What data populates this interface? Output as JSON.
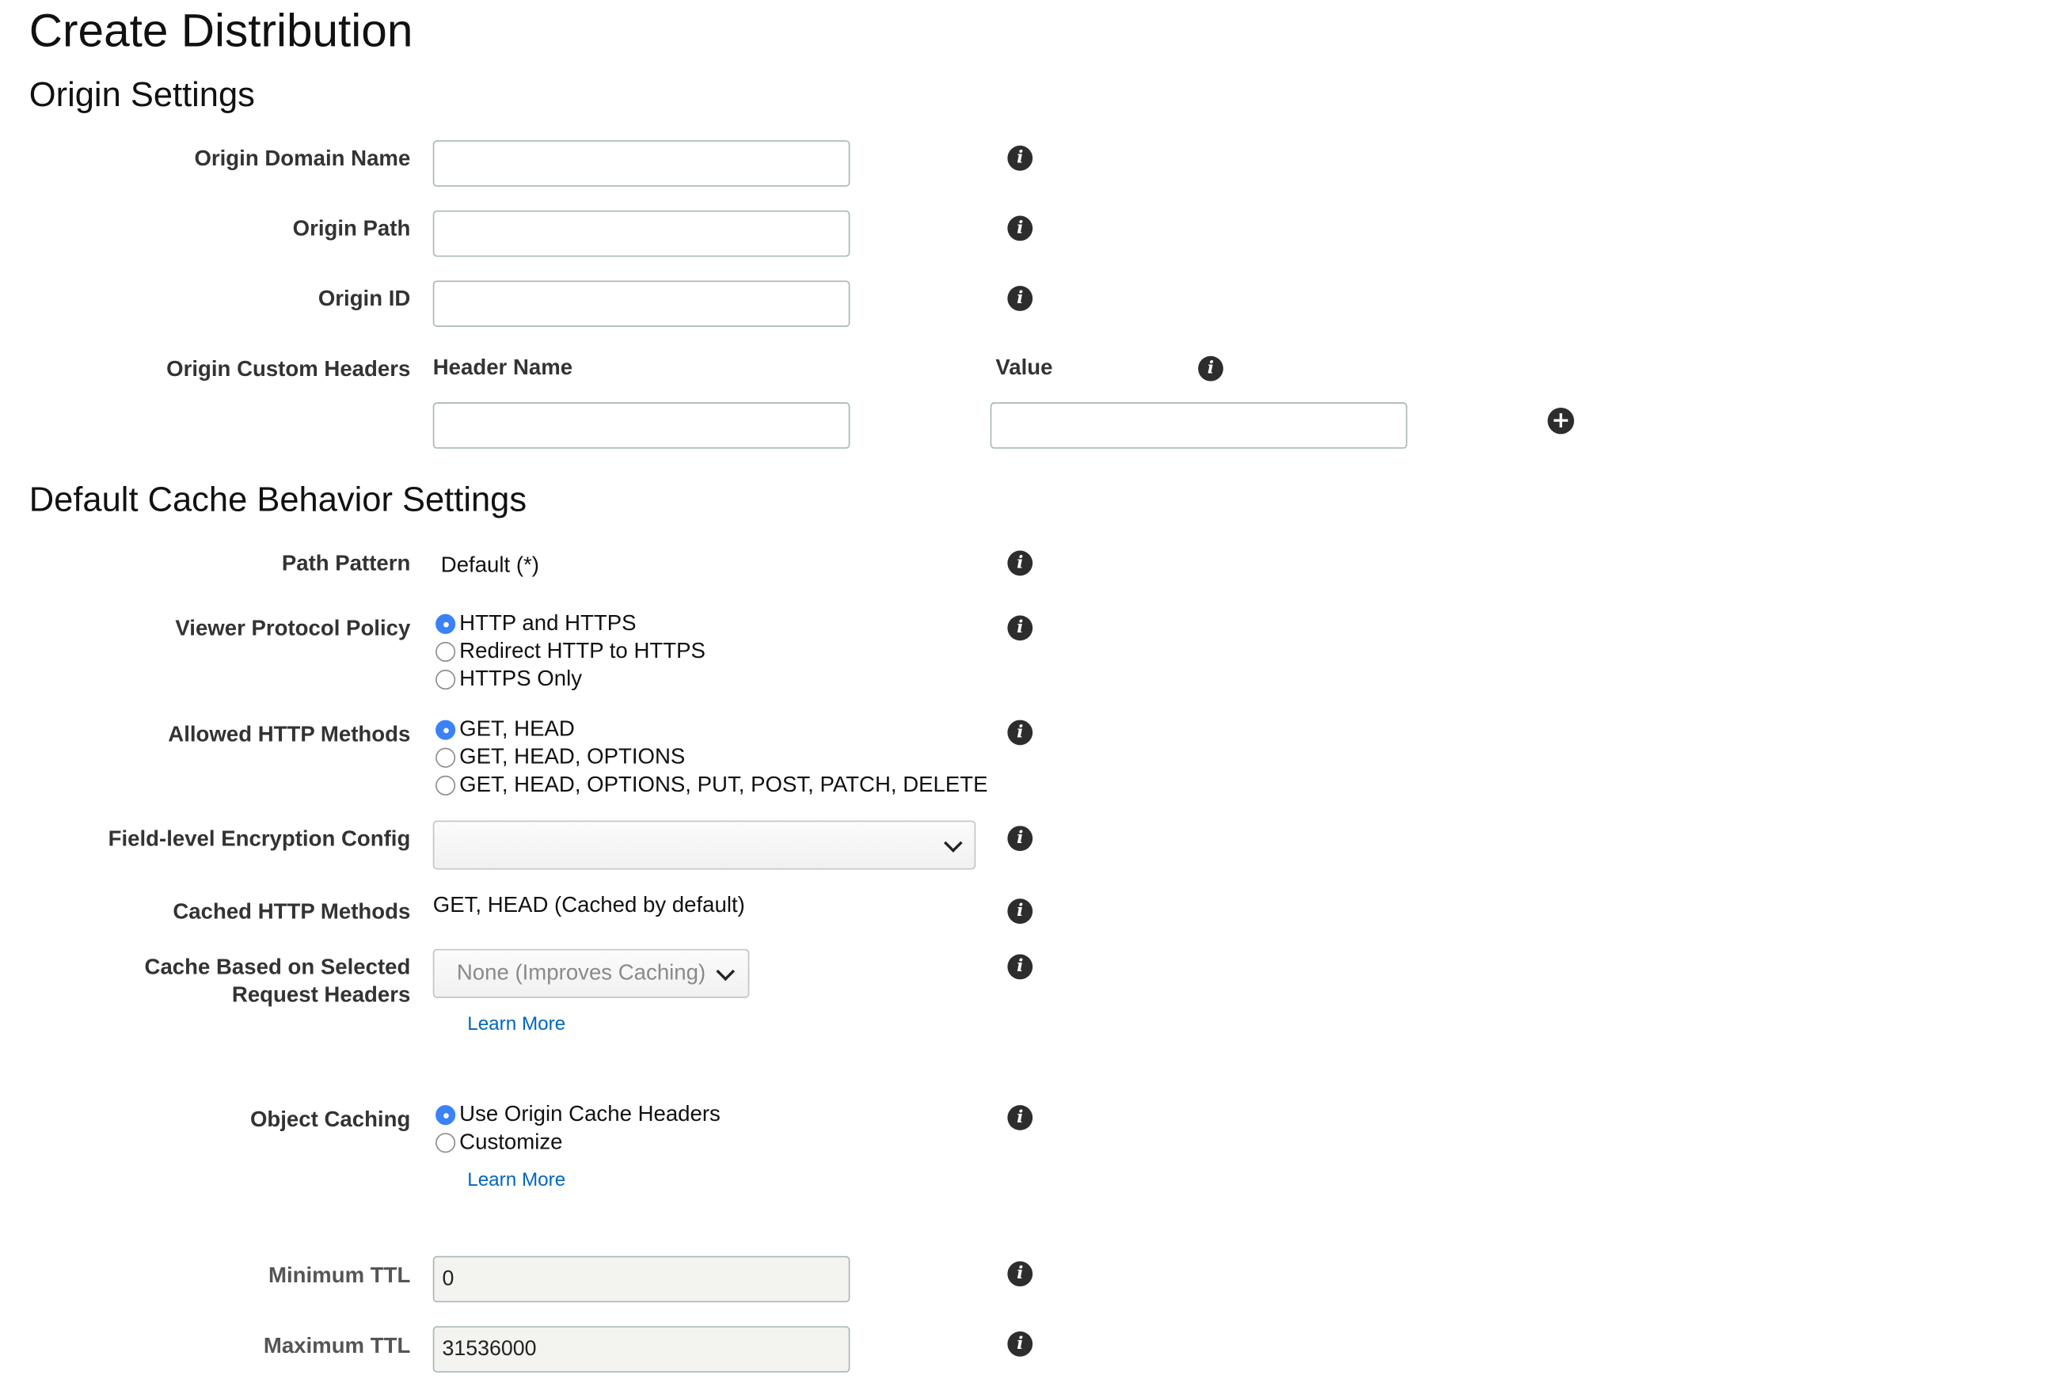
{
  "page_title": "Create Distribution",
  "origin_settings": {
    "heading": "Origin Settings",
    "domain_name_label": "Origin Domain Name",
    "domain_name_value": "",
    "path_label": "Origin Path",
    "path_value": "",
    "id_label": "Origin ID",
    "id_value": "",
    "custom_headers_label": "Origin Custom Headers",
    "header_name_col": "Header Name",
    "value_col": "Value",
    "header_name_value": "",
    "header_value_value": ""
  },
  "cache_behavior": {
    "heading": "Default Cache Behavior Settings",
    "path_pattern_label": "Path Pattern",
    "path_pattern_value": "Default (*)",
    "viewer_protocol_label": "Viewer Protocol Policy",
    "viewer_protocol_options": [
      {
        "label": "HTTP and HTTPS",
        "selected": true
      },
      {
        "label": "Redirect HTTP to HTTPS",
        "selected": false
      },
      {
        "label": "HTTPS Only",
        "selected": false
      }
    ],
    "allowed_methods_label": "Allowed HTTP Methods",
    "allowed_methods_options": [
      {
        "label": "GET, HEAD",
        "selected": true
      },
      {
        "label": "GET, HEAD, OPTIONS",
        "selected": false
      },
      {
        "label": "GET, HEAD, OPTIONS, PUT, POST, PATCH, DELETE",
        "selected": false
      }
    ],
    "fle_label": "Field-level Encryption Config",
    "fle_value": "",
    "cached_methods_label": "Cached HTTP Methods",
    "cached_methods_value": "GET, HEAD (Cached by default)",
    "cache_headers_label_line1": "Cache Based on Selected",
    "cache_headers_label_line2": "Request Headers",
    "cache_headers_value": "None (Improves Caching)",
    "learn_more_1": "Learn More",
    "object_caching_label": "Object Caching",
    "object_caching_options": [
      {
        "label": "Use Origin Cache Headers",
        "selected": true
      },
      {
        "label": "Customize",
        "selected": false
      }
    ],
    "learn_more_2": "Learn More",
    "min_ttl_label": "Minimum TTL",
    "min_ttl_value": "0",
    "max_ttl_label": "Maximum TTL",
    "max_ttl_value": "31536000"
  },
  "icons": {
    "info": "info-icon",
    "add": "add-circle-icon",
    "dropdown": "chevron-down-icon"
  },
  "colors": {
    "radio_selected": "#3b82f6",
    "link": "#0066c0",
    "readonly_field": "#f3f3ef"
  }
}
